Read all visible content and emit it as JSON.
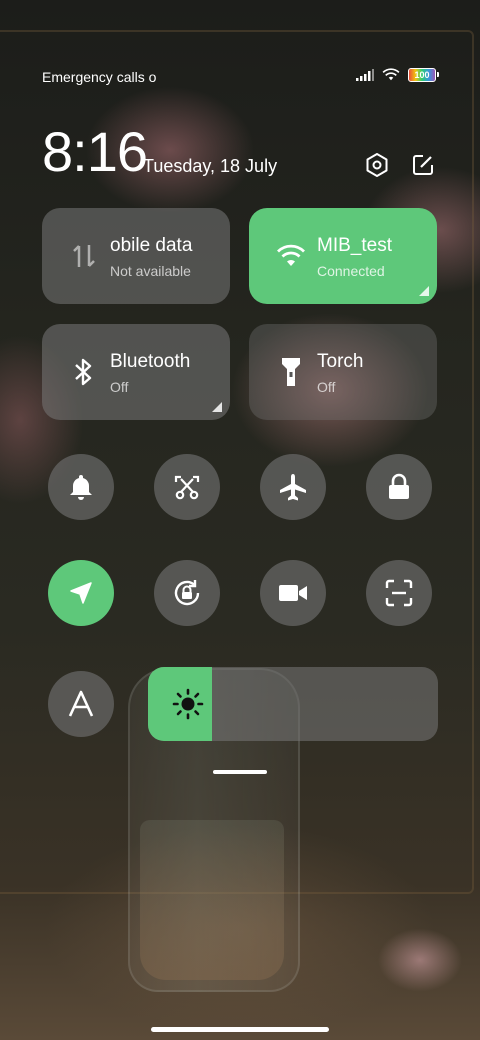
{
  "status_bar": {
    "carrier_text": "Emergency calls o",
    "battery_level": "100",
    "icons": [
      "signal-icon",
      "wifi-icon",
      "battery-icon"
    ]
  },
  "header": {
    "time": "8:16",
    "date": "Tuesday, 18 July",
    "buttons": [
      "settings-icon",
      "edit-icon"
    ]
  },
  "tiles": [
    {
      "id": "mobile-data",
      "title": "obile data",
      "subtitle": "Not available",
      "active": false,
      "icon": "mobile-data-icon"
    },
    {
      "id": "wifi",
      "title": "MIB_test",
      "subtitle": "Connected",
      "active": true,
      "icon": "wifi-icon"
    },
    {
      "id": "bluetooth",
      "title": "Bluetooth",
      "subtitle": "Off",
      "active": false,
      "icon": "bluetooth-icon"
    },
    {
      "id": "torch",
      "title": "Torch",
      "subtitle": "Off",
      "active": false,
      "icon": "torch-icon"
    }
  ],
  "toggles": [
    {
      "id": "ring",
      "icon": "bell-icon",
      "active": false
    },
    {
      "id": "screenshot",
      "icon": "scissors-icon",
      "active": false
    },
    {
      "id": "airplane",
      "icon": "airplane-icon",
      "active": false
    },
    {
      "id": "lock",
      "icon": "lock-icon",
      "active": false
    },
    {
      "id": "location",
      "icon": "location-icon",
      "active": true
    },
    {
      "id": "rotation-lock",
      "icon": "rotation-lock-icon",
      "active": false
    },
    {
      "id": "screen-record",
      "icon": "video-camera-icon",
      "active": false
    },
    {
      "id": "scanner",
      "icon": "scanner-icon",
      "active": false
    },
    {
      "id": "auto-brightness",
      "icon": "font-a-icon",
      "active": false
    }
  ],
  "brightness": {
    "level": 0.22,
    "icon": "sun-icon"
  },
  "colors": {
    "accent": "#5ec87a",
    "tile_bg": "#787878"
  }
}
